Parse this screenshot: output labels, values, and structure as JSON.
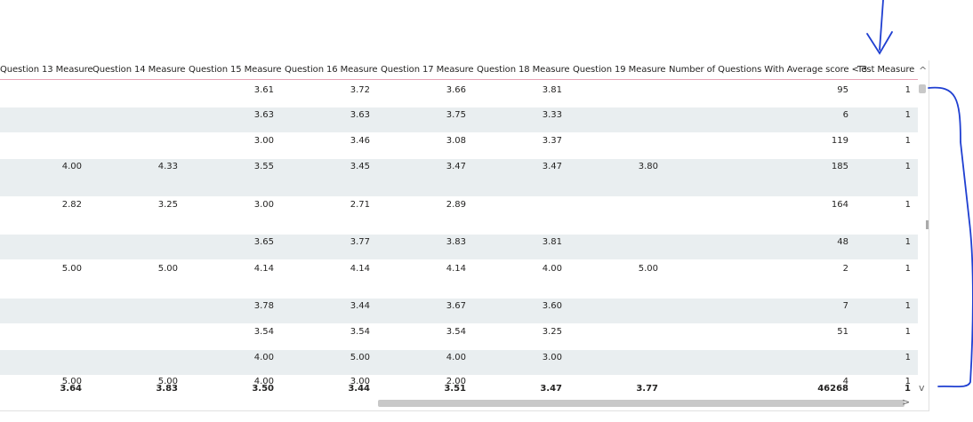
{
  "columns": [
    "Question 13 Measure",
    "Question 14 Measure",
    "Question 15 Measure",
    "Question 16 Measure",
    "Question 17 Measure",
    "Question 18 Measure",
    "Question 19 Measure",
    "Number of Questions With Average score < 3",
    "Test Measure"
  ],
  "rows": [
    [
      "",
      "",
      "3.61",
      "3.72",
      "3.66",
      "3.81",
      "",
      "95",
      "1"
    ],
    [
      "",
      "",
      "3.63",
      "3.63",
      "3.75",
      "3.33",
      "",
      "6",
      "1"
    ],
    [
      "",
      "",
      "3.00",
      "3.46",
      "3.08",
      "3.37",
      "",
      "119",
      "1"
    ],
    [
      "4.00",
      "4.33",
      "3.55",
      "3.45",
      "3.47",
      "3.47",
      "3.80",
      "185",
      "1"
    ],
    [
      "2.82",
      "3.25",
      "3.00",
      "2.71",
      "2.89",
      "",
      "",
      "164",
      "1"
    ],
    [
      "",
      "",
      "3.65",
      "3.77",
      "3.83",
      "3.81",
      "",
      "48",
      "1"
    ],
    [
      "5.00",
      "5.00",
      "4.14",
      "4.14",
      "4.14",
      "4.00",
      "5.00",
      "2",
      "1"
    ],
    [
      "",
      "",
      "3.78",
      "3.44",
      "3.67",
      "3.60",
      "",
      "7",
      "1"
    ],
    [
      "",
      "",
      "3.54",
      "3.54",
      "3.54",
      "3.25",
      "",
      "51",
      "1"
    ],
    [
      "",
      "",
      "4.00",
      "5.00",
      "4.00",
      "3.00",
      "",
      "",
      "1"
    ],
    [
      "5.00",
      "5.00",
      "4.00",
      "3.00",
      "2.00",
      "",
      "",
      "4",
      "1"
    ]
  ],
  "totals": [
    "3.64",
    "3.83",
    "3.50",
    "3.44",
    "3.51",
    "3.47",
    "3.77",
    "46268",
    "1"
  ],
  "scroll": {
    "up_glyph": "^",
    "down_glyph": "v",
    "right_glyph": ">"
  },
  "colors": {
    "row_alt": "#e9eef0",
    "header_underline": "#e8a3b5",
    "annotation": "#1f3fd1"
  }
}
